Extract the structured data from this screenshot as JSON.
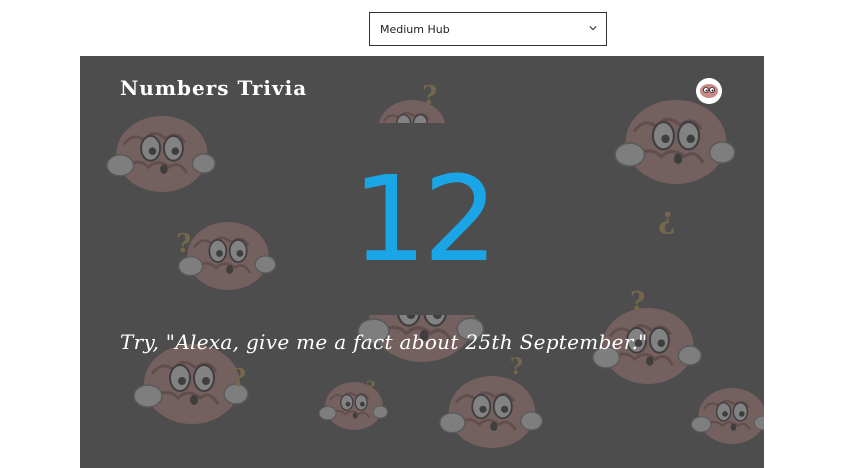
{
  "device_selector": {
    "value": "Medium Hub"
  },
  "card": {
    "title": "Numbers Trivia",
    "number": "12",
    "hint": "Try, \"Alexa, give me a fact about 25th September.\""
  },
  "icons": {
    "dropdown": "chevron-down-icon",
    "skill": "brain-logo-icon",
    "background": "cartoon-brain-pattern"
  },
  "colors": {
    "background": "#4d4d4d",
    "number": "#1aa6e6",
    "text": "#ffffff"
  }
}
